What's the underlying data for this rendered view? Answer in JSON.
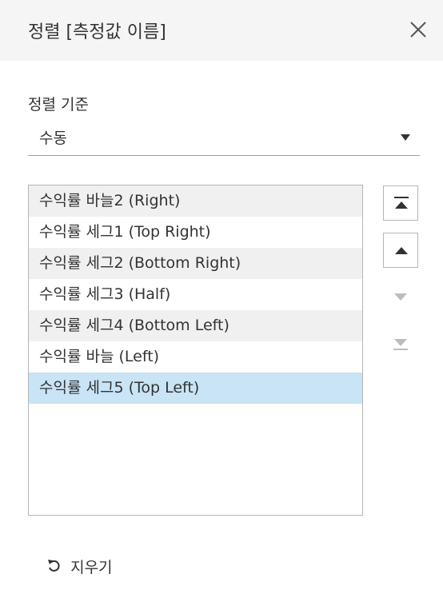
{
  "dialog": {
    "title": "정렬 [측정값 이름]",
    "close_icon": "close-icon"
  },
  "sort_by": {
    "label": "정렬 기준",
    "value": "수동"
  },
  "list": {
    "items": [
      {
        "label": "수익률 바늘2 (Right)"
      },
      {
        "label": "수익률 세그1 (Top Right)"
      },
      {
        "label": "수익률 세그2 (Bottom Right)"
      },
      {
        "label": "수익률 세그3 (Half)"
      },
      {
        "label": "수익률 세그4 (Bottom Left)"
      },
      {
        "label": "수익률 바늘 (Left)"
      },
      {
        "label": "수익률 세그5 (Top Left)"
      }
    ],
    "selected_index": 6
  },
  "move_buttons": {
    "move_to_top_icon": "move-to-top-icon",
    "move_up_icon": "move-up-icon",
    "move_down_icon": "move-down-icon",
    "move_to_bottom_icon": "move-to-bottom-icon"
  },
  "footer": {
    "clear_label": "지우기",
    "clear_icon": "undo-icon"
  },
  "colors": {
    "header_bg": "#f5f5f5",
    "selected_row": "#c8e4f5",
    "alt_row": "#f0f0f0",
    "disabled_icon": "#bdbdbd"
  }
}
